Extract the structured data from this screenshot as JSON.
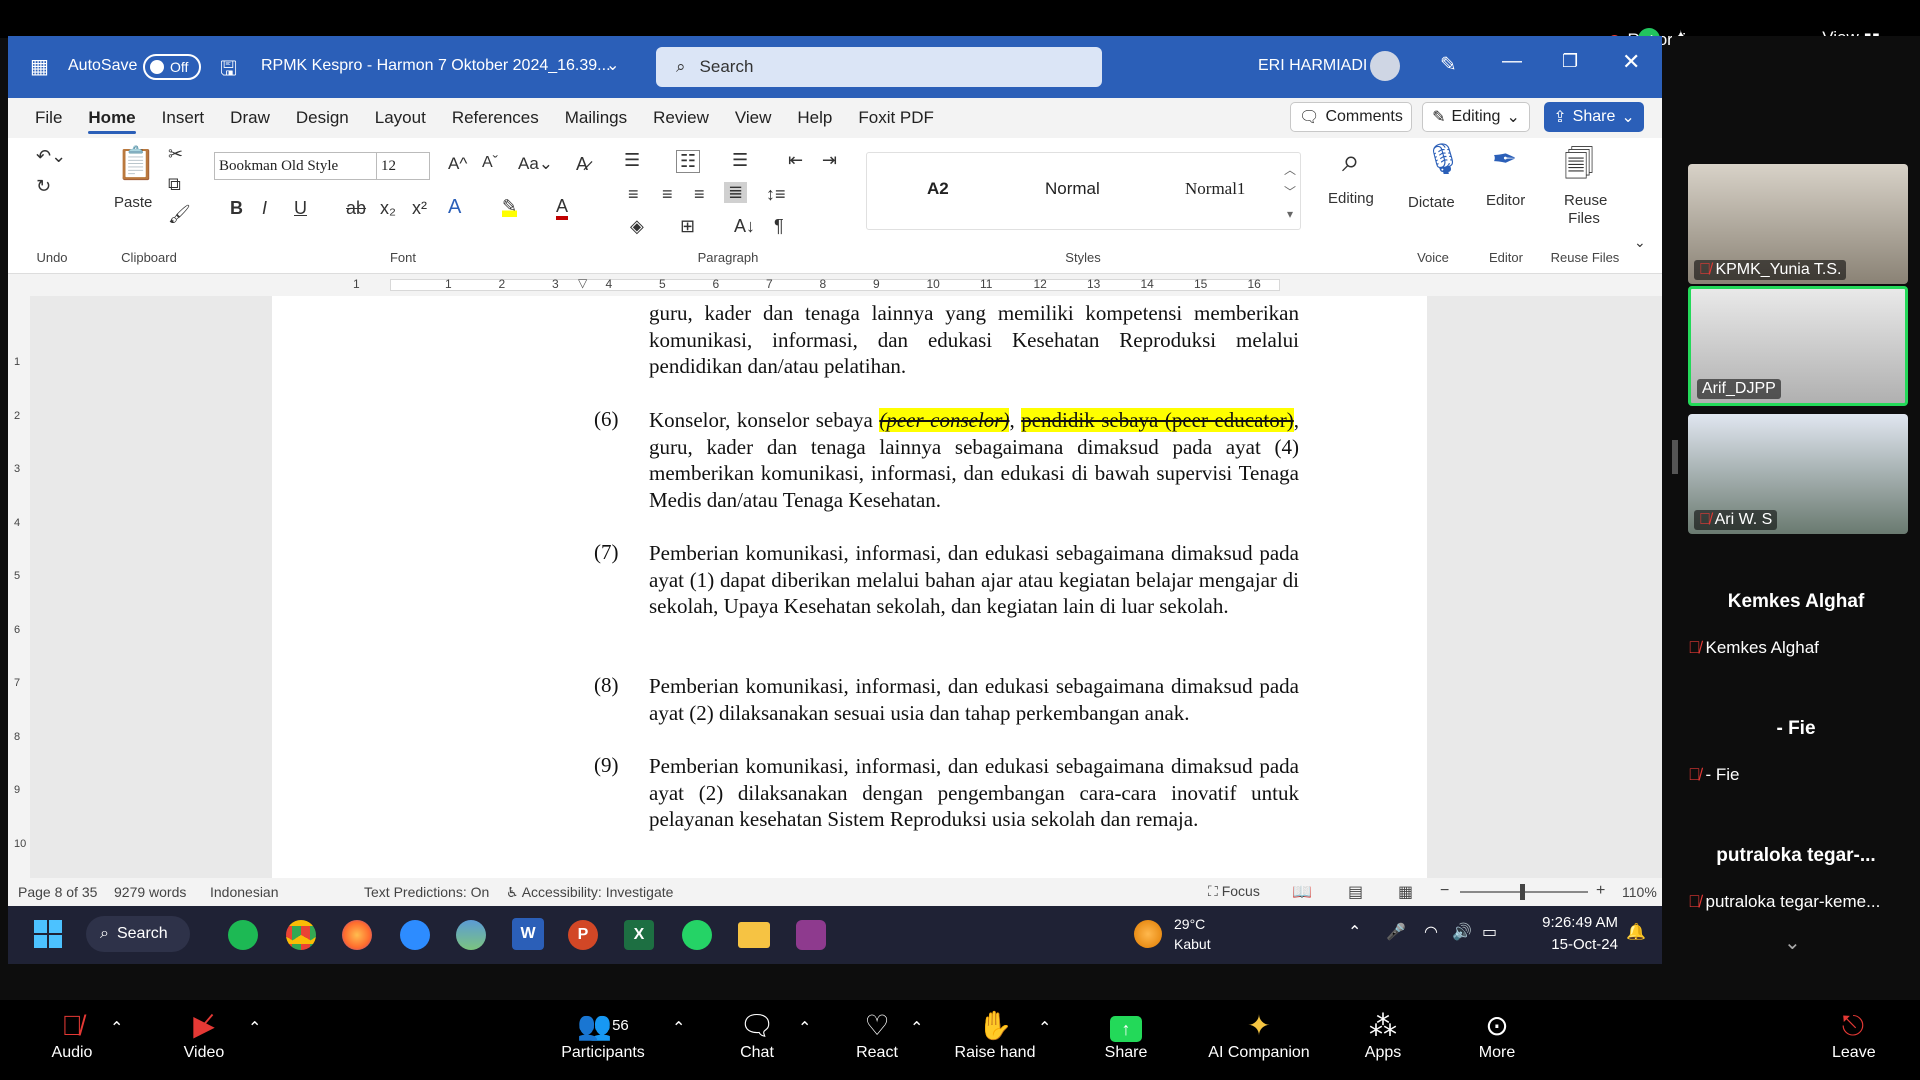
{
  "zoom_top": {
    "recording": "Recording",
    "view": "View"
  },
  "title": {
    "autosave": "AutoSave",
    "autosave_state": "Off",
    "doc_name": "RPMK Kespro - Harmon 7 Oktober 2024_16.39...",
    "search": "Search",
    "user": "ERI HARMIADI"
  },
  "menu": [
    "File",
    "Home",
    "Insert",
    "Draw",
    "Design",
    "Layout",
    "References",
    "Mailings",
    "Review",
    "View",
    "Help",
    "Foxit PDF"
  ],
  "menu_right": {
    "comments": "Comments",
    "editing": "Editing",
    "share": "Share"
  },
  "ribbon": {
    "undo_label": "Undo",
    "paste": "Paste",
    "clipboard_label": "Clipboard",
    "font_name": "Bookman Old Style",
    "font_size": "12",
    "font_label": "Font",
    "paragraph_label": "Paragraph",
    "styles": [
      "A2",
      "Normal",
      "Normal1"
    ],
    "styles_label": "Styles",
    "editing": "Editing",
    "dictate": "Dictate",
    "voice_label": "Voice",
    "editor": "Editor",
    "editor_label": "Editor",
    "reuse_files": "Reuse Files",
    "reuse_label": "Reuse Files"
  },
  "ruler_numbers": [
    "1",
    "1",
    "2",
    "3",
    "4",
    "5",
    "6",
    "7",
    "8",
    "9",
    "10",
    "11",
    "12",
    "13",
    "14",
    "15",
    "16"
  ],
  "vruler_numbers": [
    "1",
    "2",
    "3",
    "4",
    "5",
    "6",
    "7",
    "8",
    "9",
    "10"
  ],
  "document": {
    "lead": "guru, kader dan tenaga lainnya yang memiliki kompetensi memberikan komunikasi, informasi, dan edukasi Kesehatan Reproduksi melalui pendidikan dan/atau pelatihan.",
    "p6_num": "(6)",
    "p6_a": "Konselor, konselor sebaya ",
    "p6_hl1": "(peer conselor)",
    "p6_b": ", ",
    "p6_hl2": "pendidik sebaya (peer educator)",
    "p6_c": ", guru, kader dan tenaga lainnya sebagaimana dimaksud pada ayat (4) memberikan komunikasi, informasi, dan edukasi di bawah supervisi Tenaga Medis dan/atau Tenaga Kesehatan.",
    "p7_num": "(7)",
    "p7": "Pemberian komunikasi, informasi, dan edukasi sebagaimana dimaksud pada ayat (1) dapat diberikan melalui bahan ajar atau kegiatan belajar mengajar di sekolah, Upaya Kesehatan sekolah, dan kegiatan lain di luar sekolah.",
    "p8_num": "(8)",
    "p8": "Pemberian komunikasi, informasi, dan edukasi sebagaimana dimaksud pada ayat (2) dilaksanakan sesuai usia dan tahap perkembangan anak.",
    "p9_num": "(9)",
    "p9": "Pemberian komunikasi, informasi, dan edukasi sebagaimana dimaksud pada ayat (2) dilaksanakan dengan pengembangan cara-cara inovatif untuk pelayanan kesehatan Sistem Reproduksi usia sekolah dan remaja."
  },
  "status": {
    "page": "Page 8 of 35",
    "words": "9279 words",
    "lang": "Indonesian",
    "predictions": "Text Predictions: On",
    "accessibility": "Accessibility: Investigate",
    "focus": "Focus",
    "zoom": "110%"
  },
  "taskbar": {
    "search": "Search",
    "weather_temp": "29°C",
    "weather_desc": "Kabut",
    "time": "9:26:49 AM",
    "date": "15-Oct-24"
  },
  "zoom_bottom": {
    "audio": "Audio",
    "video": "Video",
    "participants": "Participants",
    "participants_count": "56",
    "chat": "Chat",
    "react": "React",
    "raise": "Raise hand",
    "share": "Share",
    "ai": "AI Companion",
    "apps": "Apps",
    "more": "More",
    "leave": "Leave"
  },
  "participants": {
    "tile1": "KPMK_Yunia T.S.",
    "tile2": "Arif_DJPP",
    "tile3": "Ari W. S",
    "n1_big": "Kemkes Alghaf",
    "n1_small": "Kemkes Alghaf",
    "n2_big": "- Fie",
    "n2_small": "- Fie",
    "n3_big": "putraloka tegar-...",
    "n3_small": "putraloka tegar-keme..."
  },
  "colors": {
    "word_blue": "#2b5fb8",
    "highlight": "#ffff00",
    "zoom_share": "#23d959",
    "mic_off": "#e53935"
  }
}
